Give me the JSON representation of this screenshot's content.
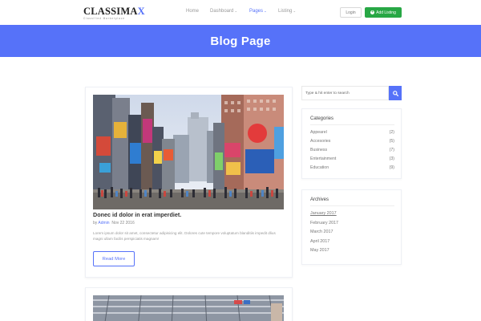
{
  "brand": {
    "name_main": "CLASSIMA",
    "name_accent": "X",
    "tagline": "Classified Marketplace"
  },
  "nav": {
    "links": [
      {
        "label": "Home",
        "has_caret": false,
        "active": false
      },
      {
        "label": "Dashboard",
        "has_caret": true,
        "active": false
      },
      {
        "label": "Pages",
        "has_caret": true,
        "active": true
      },
      {
        "label": "Listing",
        "has_caret": true,
        "active": false
      }
    ],
    "caret_glyph": "⌄",
    "login_label": "Login",
    "add_listing_label": "Add Listing"
  },
  "hero": {
    "title": "Blog Page"
  },
  "posts": [
    {
      "title": "Donec id dolor in erat imperdiet.",
      "by": "by",
      "author": "Admin",
      "date": "Nov 22 2016",
      "body": "Lorem ipsum dolor sit amet, consectetur adipisicing elit. Dolores cute tempore voluptatum blanditiis impedit dlius magni ullam facilis perspiciatis magnam!",
      "read_more": "Read More"
    }
  ],
  "search": {
    "placeholder": "Type & hit enter to search"
  },
  "categories": {
    "title": "Categories",
    "items": [
      {
        "name": "Appearel",
        "count": "(2)"
      },
      {
        "name": "Accesories",
        "count": "(5)"
      },
      {
        "name": "Business",
        "count": "(7)"
      },
      {
        "name": "Entertainment",
        "count": "(3)"
      },
      {
        "name": "Education",
        "count": "(9)"
      }
    ]
  },
  "archives": {
    "title": "Archives",
    "items": [
      "January 2017",
      "February 2017",
      "March 2017",
      "April 2017",
      "May 2017"
    ]
  },
  "colors": {
    "primary": "#5672f9",
    "success": "#28a745"
  }
}
